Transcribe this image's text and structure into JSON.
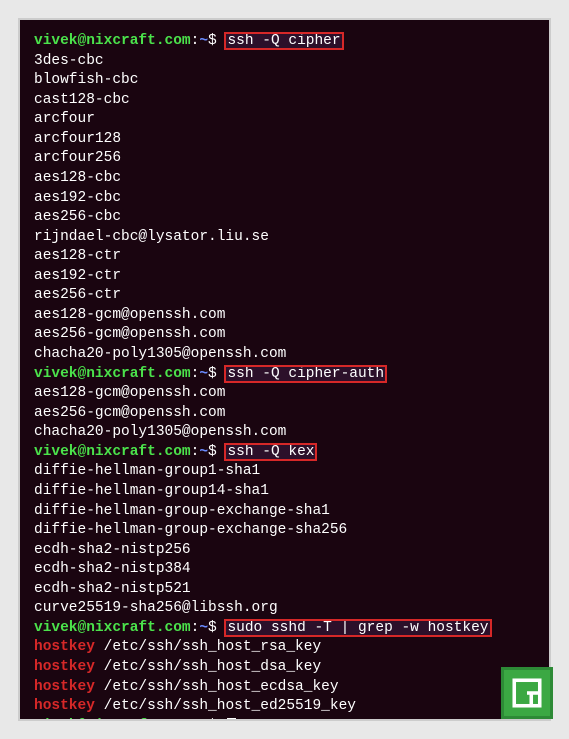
{
  "prompt": {
    "user": "vivek",
    "host": "nixcraft.com",
    "path": "~",
    "symbol": "$"
  },
  "blocks": [
    {
      "command": "ssh -Q cipher",
      "output": [
        "3des-cbc",
        "blowfish-cbc",
        "cast128-cbc",
        "arcfour",
        "arcfour128",
        "arcfour256",
        "aes128-cbc",
        "aes192-cbc",
        "aes256-cbc",
        "rijndael-cbc@lysator.liu.se",
        "aes128-ctr",
        "aes192-ctr",
        "aes256-ctr",
        "aes128-gcm@openssh.com",
        "aes256-gcm@openssh.com",
        "chacha20-poly1305@openssh.com"
      ]
    },
    {
      "command": "ssh -Q cipher-auth",
      "output": [
        "aes128-gcm@openssh.com",
        "aes256-gcm@openssh.com",
        "chacha20-poly1305@openssh.com"
      ]
    },
    {
      "command": "ssh -Q kex",
      "output": [
        "diffie-hellman-group1-sha1",
        "diffie-hellman-group14-sha1",
        "diffie-hellman-group-exchange-sha1",
        "diffie-hellman-group-exchange-sha256",
        "ecdh-sha2-nistp256",
        "ecdh-sha2-nistp384",
        "ecdh-sha2-nistp521",
        "curve25519-sha256@libssh.org"
      ]
    },
    {
      "command": "sudo sshd -T | grep -w hostkey",
      "output_hostkey": [
        "/etc/ssh/ssh_host_rsa_key",
        "/etc/ssh/ssh_host_dsa_key",
        "/etc/ssh/ssh_host_ecdsa_key",
        "/etc/ssh/ssh_host_ed25519_key"
      ]
    }
  ],
  "hostkey_label": "hostkey",
  "badge": {
    "letter": "G",
    "bg": "#3ba843",
    "border": "#2d8a36"
  }
}
